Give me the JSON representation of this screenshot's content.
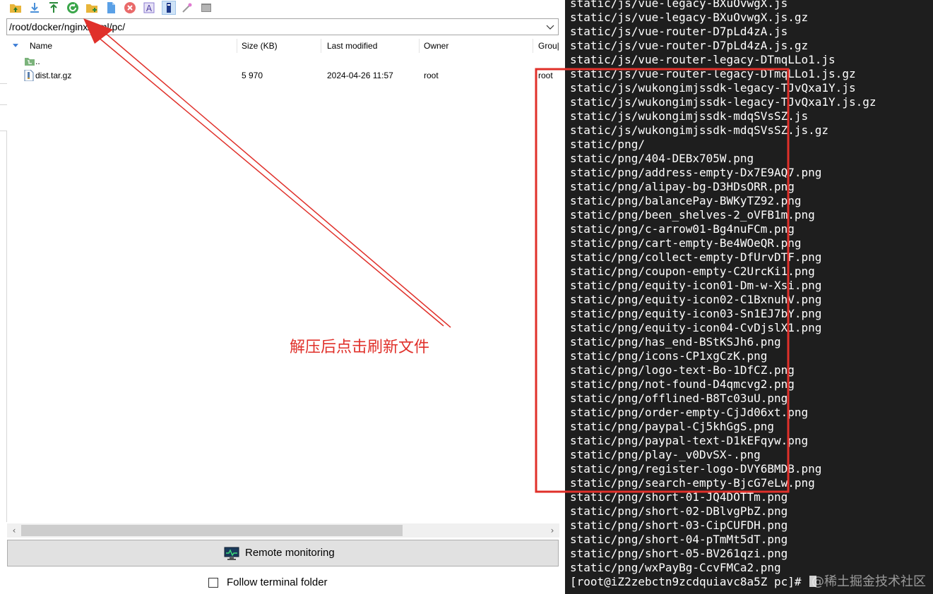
{
  "toolbar": {
    "icons": [
      "parent-folder-icon",
      "download-icon",
      "upload-icon",
      "refresh-icon",
      "new-folder-icon",
      "new-file-icon",
      "delete-icon",
      "rename-icon",
      "properties-icon",
      "wand-icon",
      "terminal-icon"
    ]
  },
  "path": {
    "value": "/root/docker/nginx/html/pc/"
  },
  "columns": {
    "name": "Name",
    "size": "Size (KB)",
    "modified": "Last modified",
    "owner": "Owner",
    "group": "Grou|"
  },
  "files": [
    {
      "name": "..",
      "size": "",
      "modified": "",
      "owner": "",
      "group": ""
    },
    {
      "name": "dist.tar.gz",
      "size": "5 970",
      "modified": "2024-04-26 11:57",
      "owner": "root",
      "group": "root"
    }
  ],
  "remote": {
    "label": "Remote monitoring"
  },
  "follow": {
    "label": "Follow terminal folder"
  },
  "terminal": {
    "lines": [
      "static/js/vue-legacy-BXuOvwgX.js",
      "static/js/vue-legacy-BXuOvwgX.js.gz",
      "static/js/vue-router-D7pLd4zA.js",
      "static/js/vue-router-D7pLd4zA.js.gz",
      "static/js/vue-router-legacy-DTmqLLo1.js",
      "static/js/vue-router-legacy-DTmqLLo1.js.gz",
      "static/js/wukongimjssdk-legacy-TJvQxa1Y.js",
      "static/js/wukongimjssdk-legacy-TJvQxa1Y.js.gz",
      "static/js/wukongimjssdk-mdqSVsSZ.js",
      "static/js/wukongimjssdk-mdqSVsSZ.js.gz",
      "static/png/",
      "static/png/404-DEBx705W.png",
      "static/png/address-empty-Dx7E9AQ7.png",
      "static/png/alipay-bg-D3HDsORR.png",
      "static/png/balancePay-BWKyTZ92.png",
      "static/png/been_shelves-2_oVFB1m.png",
      "static/png/c-arrow01-Bg4nuFCm.png",
      "static/png/cart-empty-Be4WOeQR.png",
      "static/png/collect-empty-DfUrvDTF.png",
      "static/png/coupon-empty-C2UrcKi1.png",
      "static/png/equity-icon01-Dm-w-Xsi.png",
      "static/png/equity-icon02-C1BxnuhV.png",
      "static/png/equity-icon03-Sn1EJ7bY.png",
      "static/png/equity-icon04-CvDjslX1.png",
      "static/png/has_end-BStKSJh6.png",
      "static/png/icons-CP1xgCzK.png",
      "static/png/logo-text-Bo-1DfCZ.png",
      "static/png/not-found-D4qmcvg2.png",
      "static/png/offlined-B8Tc03uU.png",
      "static/png/order-empty-CjJd06xt.png",
      "static/png/paypal-Cj5khGgS.png",
      "static/png/paypal-text-D1kEFqyw.png",
      "static/png/play-_v0DvSX-.png",
      "static/png/register-logo-DVY6BMDB.png",
      "static/png/search-empty-BjcG7eLw.png",
      "static/png/short-01-JQ4DOTTm.png",
      "static/png/short-02-DBlvgPbZ.png",
      "static/png/short-03-CipCUFDH.png",
      "static/png/short-04-pTmMt5dT.png",
      "static/png/short-05-BV261qzi.png",
      "static/png/wxPayBg-CcvFMCa2.png"
    ],
    "prompt": "[root@iZ2zebctn9zcdquiavc8a5Z pc]# "
  },
  "watermark": "@稀土掘金技术社区",
  "annotation": {
    "text": "解压后点击刷新文件",
    "color": "#e0302a"
  }
}
